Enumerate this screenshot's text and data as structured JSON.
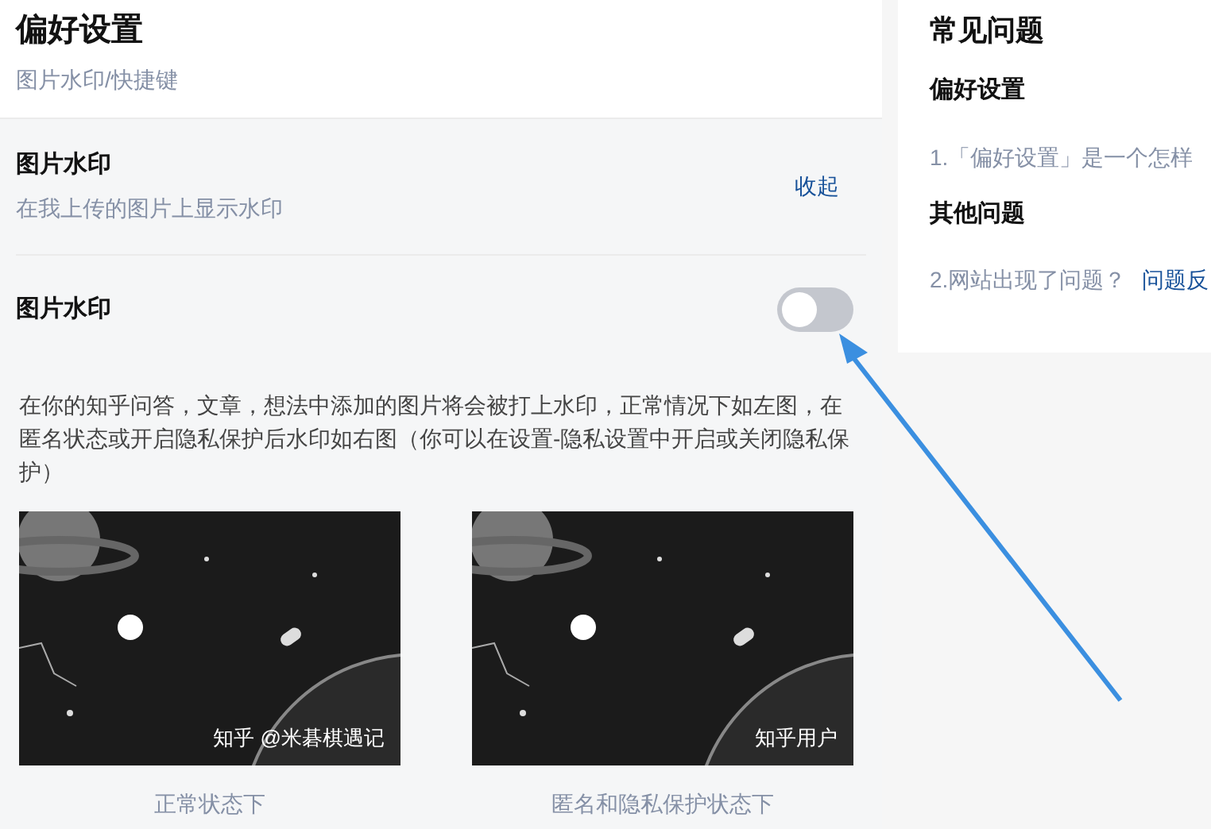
{
  "header": {
    "title": "偏好设置",
    "subtitle": "图片水印/快捷键"
  },
  "section": {
    "title": "图片水印",
    "description": "在我上传的图片上显示水印",
    "collapse_link": "收起"
  },
  "setting": {
    "label": "图片水印",
    "on": false
  },
  "explanation": "在你的知乎问答，文章，想法中添加的图片将会被打上水印，正常情况下如左图，在匿名状态或开启隐私保护后水印如右图（你可以在设置-隐私设置中开启或关闭隐私保护）",
  "examples": [
    {
      "watermark": "知乎 @米碁棋遇记",
      "caption": "正常状态下"
    },
    {
      "watermark": "知乎用户",
      "caption": "匿名和隐私保护状态下"
    }
  ],
  "faq": {
    "title": "常见问题",
    "groups": [
      {
        "heading": "偏好设置",
        "items": [
          {
            "text": "1.「偏好设置」是一个怎样"
          }
        ]
      },
      {
        "heading": "其他问题",
        "items": [
          {
            "text": "2.网站出现了问题？",
            "link": "问题反"
          }
        ]
      }
    ]
  }
}
